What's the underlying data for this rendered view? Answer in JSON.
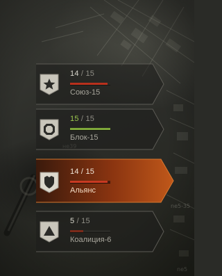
{
  "clans": [
    {
      "current": "14",
      "separator": "/",
      "total": "15",
      "name": "Союз-15",
      "progress": 0.93,
      "bar_color": "#b8301c",
      "current_color": "#d8d6cc",
      "active": false,
      "icon": "star-icon"
    },
    {
      "current": "15",
      "separator": "/",
      "total": "15",
      "name": "Блок-15",
      "progress": 1.0,
      "bar_color": "#7ea83a",
      "current_color": "#9cc84e",
      "active": false,
      "icon": "octagon-icon"
    },
    {
      "current": "14",
      "separator": "/",
      "total": "15",
      "name": "Альянс",
      "progress": 0.93,
      "bar_color": "#c83a22",
      "current_color": "#f0e6d8",
      "active": true,
      "icon": "shield-icon"
    },
    {
      "current": "5",
      "separator": "/",
      "total": "15",
      "name": "Коалиция-6",
      "progress": 0.33,
      "bar_color": "#7a2a1a",
      "current_color": "#d8d6cc",
      "active": false,
      "icon": "triangle-icon"
    }
  ],
  "colors": {
    "active_accent": "#a8440f",
    "panel": "#2e2e2a",
    "border": "#6e6d66"
  }
}
